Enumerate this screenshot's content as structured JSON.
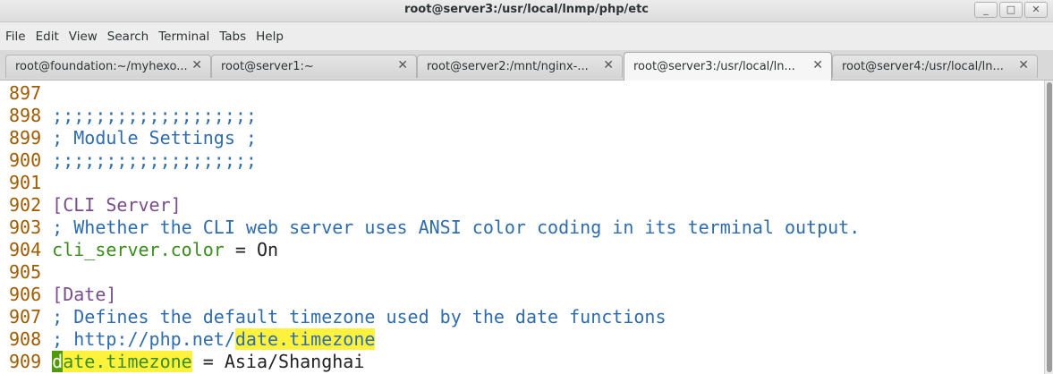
{
  "window": {
    "title": "root@server3:/usr/local/lnmp/php/etc",
    "buttons": [
      "_",
      "□",
      "✕"
    ]
  },
  "menu": [
    "File",
    "Edit",
    "View",
    "Search",
    "Terminal",
    "Tabs",
    "Help"
  ],
  "tabs": [
    {
      "label": "root@foundation:~/myhexo...",
      "close": "✕",
      "active": false
    },
    {
      "label": "root@server1:~",
      "close": "✕",
      "active": false
    },
    {
      "label": "root@server2:/mnt/nginx-...",
      "close": "✕",
      "active": false
    },
    {
      "label": "root@server3:/usr/local/ln...",
      "close": "✕",
      "active": true
    },
    {
      "label": "root@server4:/usr/local/ln...",
      "close": "✕",
      "active": false
    }
  ],
  "terminal": {
    "lines": [
      {
        "num": "897",
        "segments": []
      },
      {
        "num": "898",
        "segments": [
          {
            "text": ";;;;;;;;;;;;;;;;;;;",
            "style": "comment"
          }
        ]
      },
      {
        "num": "899",
        "segments": [
          {
            "text": "; Module Settings ;",
            "style": "comment"
          }
        ]
      },
      {
        "num": "900",
        "segments": [
          {
            "text": ";;;;;;;;;;;;;;;;;;;",
            "style": "comment"
          }
        ]
      },
      {
        "num": "901",
        "segments": []
      },
      {
        "num": "902",
        "segments": [
          {
            "text": "[CLI Server]",
            "style": "section"
          }
        ]
      },
      {
        "num": "903",
        "segments": [
          {
            "text": "; Whether the CLI web server uses ANSI color coding in its terminal output.",
            "style": "comment"
          }
        ]
      },
      {
        "num": "904",
        "segments": [
          {
            "text": "cli_server.color",
            "style": "key"
          },
          {
            "text": " = On",
            "style": "plain"
          }
        ]
      },
      {
        "num": "905",
        "segments": []
      },
      {
        "num": "906",
        "segments": [
          {
            "text": "[Date]",
            "style": "section"
          }
        ]
      },
      {
        "num": "907",
        "segments": [
          {
            "text": "; Defines the default timezone used by the date functions",
            "style": "comment"
          }
        ]
      },
      {
        "num": "908",
        "segments": [
          {
            "text": "; http://php.net/",
            "style": "comment"
          },
          {
            "text": "date.timezone",
            "style": "comment hl"
          }
        ]
      },
      {
        "num": "909",
        "segments": [
          {
            "text": "d",
            "style": "cursor"
          },
          {
            "text": "ate.timezone",
            "style": "key hl"
          },
          {
            "text": " = Asia/Shanghai",
            "style": "plain"
          }
        ]
      }
    ]
  },
  "colors": {
    "line_number": "#a05a00",
    "comment": "#2f6cae",
    "section": "#7a4d8c",
    "key": "#3a8d1e",
    "search_highlight": "#fff23d",
    "cursor": "#4f9a06"
  }
}
